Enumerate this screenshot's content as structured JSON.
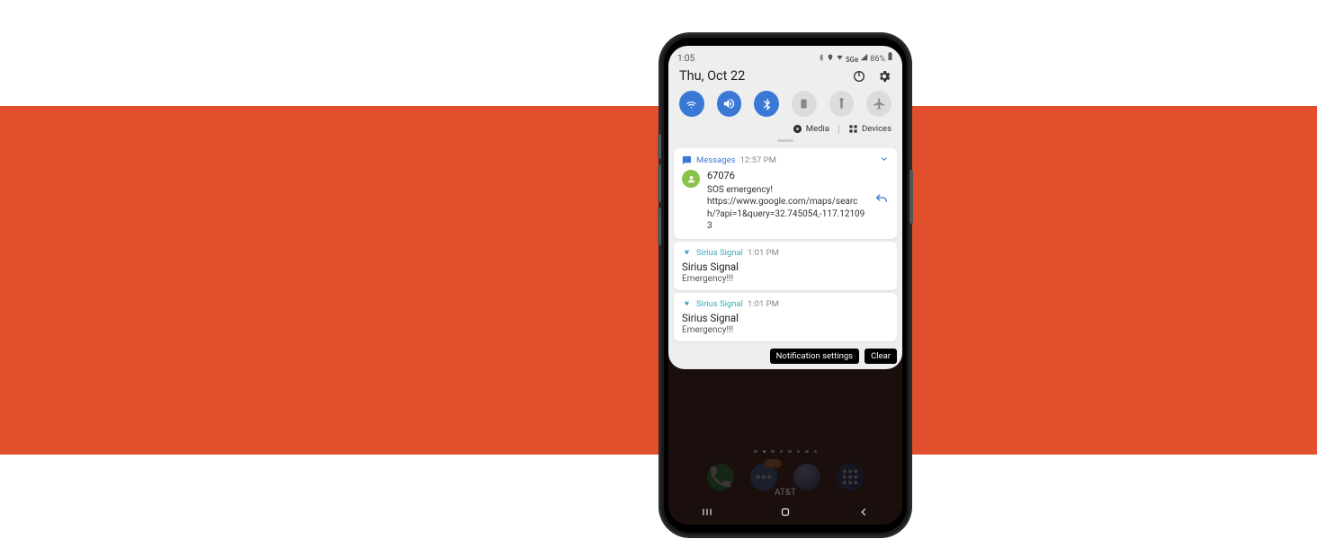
{
  "statusbar": {
    "time": "1:05",
    "network_label": "5Ge",
    "battery": "86%"
  },
  "header": {
    "date": "Thu, Oct 22"
  },
  "media_devices": {
    "media": "Media",
    "devices": "Devices"
  },
  "notifications": {
    "messages": {
      "app": "Messages",
      "time": "12:57 PM",
      "sender": "67076",
      "line1": "SOS emergency!",
      "line2": "https://www.google.com/maps/search/?api=1&query=32.745054,-117.121093"
    },
    "sirius1": {
      "app": "Sirius Signal",
      "time": "1:01 PM",
      "title": "Sirius Signal",
      "body": "Emergency!!!"
    },
    "sirius2": {
      "app": "Sirius Signal",
      "time": "1:01 PM",
      "title": "Sirius Signal",
      "body": "Emergency!!!"
    }
  },
  "actions": {
    "settings": "Notification settings",
    "clear": "Clear"
  },
  "dock": {
    "badge": "321"
  },
  "carrier": "AT&T"
}
